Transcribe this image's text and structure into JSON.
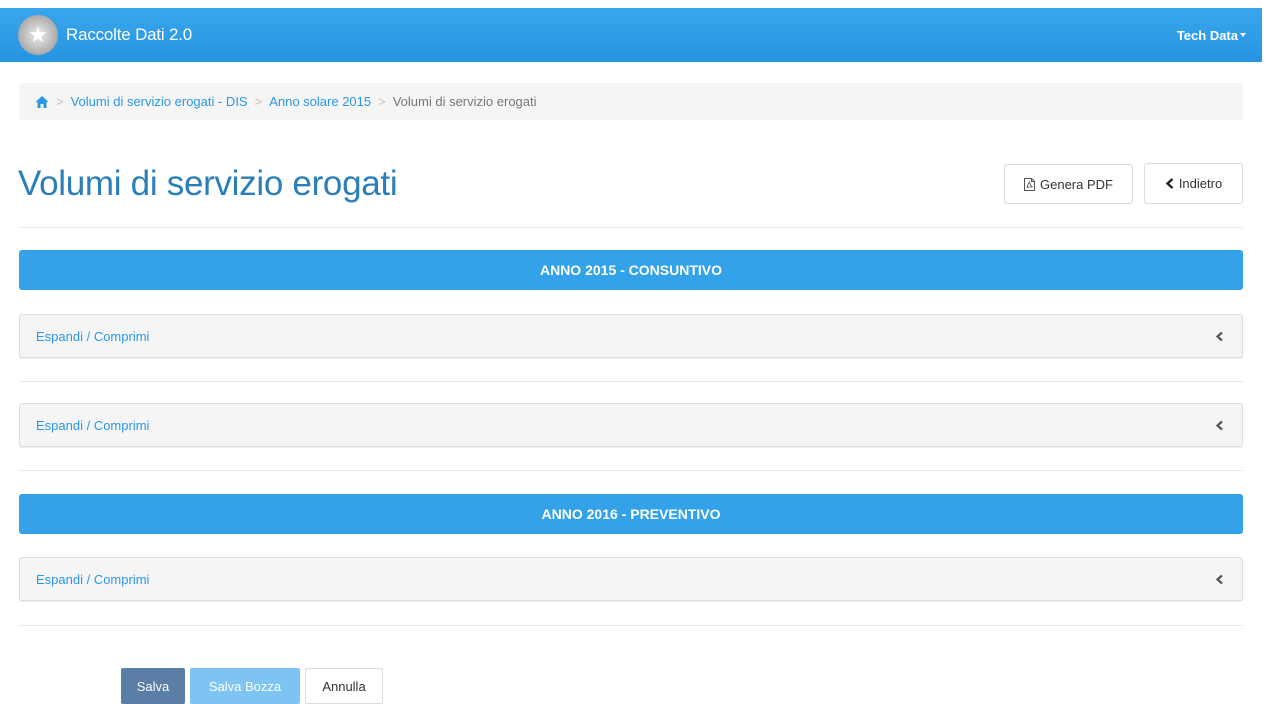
{
  "navbar": {
    "brand": "Raccolte Dati 2.0",
    "user": "Tech Data",
    "logo_icon": "star-emblem-icon",
    "color": "#2d9de8"
  },
  "breadcrumb": {
    "home_icon": "home-icon",
    "items": [
      "Volumi di servizio erogati - DIS",
      "Anno solare 2015"
    ],
    "current": "Volumi di servizio erogati"
  },
  "page": {
    "title": "Volumi di servizio erogati",
    "pdf_label": "Genera PDF",
    "back_label": "Indietro"
  },
  "sections": [
    {
      "header": "ANNO 2015 - CONSUNTIVO",
      "panels": [
        "Espandi / Comprimi",
        "Espandi / Comprimi"
      ]
    },
    {
      "header": "ANNO 2016 - PREVENTIVO",
      "panels": [
        "Espandi / Comprimi"
      ]
    }
  ],
  "actions": {
    "save": "Salva",
    "save_draft": "Salva Bozza",
    "cancel": "Annulla"
  },
  "colors": {
    "accent": "#33a2e8",
    "title": "#2b7fb8",
    "primary_button": "#5b7ea6",
    "draft_button": "#7dc4f2"
  }
}
